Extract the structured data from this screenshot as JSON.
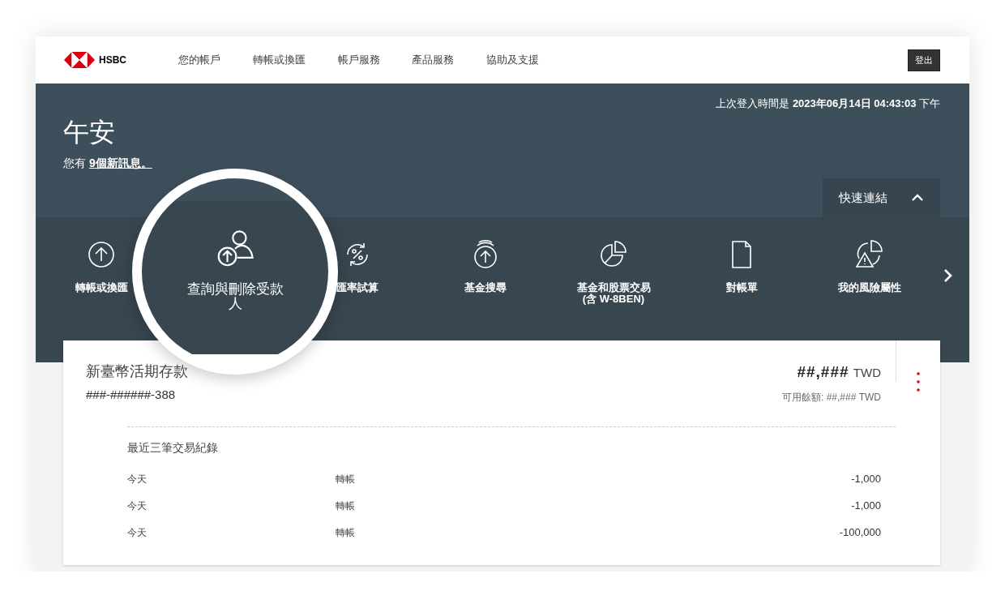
{
  "header": {
    "logo": "HSBC",
    "nav": [
      {
        "label": "您的帳戶",
        "selected": false
      },
      {
        "label": "轉帳或換匯",
        "selected": false
      },
      {
        "label": "帳戶服務",
        "selected": false
      },
      {
        "label": "產品服務",
        "selected": false
      },
      {
        "label": "協助及支援",
        "selected": false
      }
    ],
    "logout": "登出"
  },
  "hero": {
    "last_login_label": "上次登入時間是",
    "last_login_time": "2023年06月14日 04:43:03",
    "last_login_period": "下午",
    "greeting": "午安",
    "message_prefix": "您有",
    "message_link": "9個新訊息。"
  },
  "quick_links": {
    "title": "快速連結",
    "expanded": true,
    "items": [
      {
        "label": "轉帳或換匯",
        "kind": "upload"
      },
      {
        "label": "查詢與刪除受款人",
        "kind": "magnified"
      },
      {
        "label": "匯率試算",
        "kind": "exchange"
      },
      {
        "label": "基金搜尋",
        "kind": "fund"
      },
      {
        "label": "基金和股票交易\n(含 W-8BEN)",
        "kind": "trade"
      },
      {
        "label": "對帳單",
        "kind": "statement"
      },
      {
        "label": "我的風險屬性",
        "kind": "risk"
      }
    ]
  },
  "account": {
    "name": "新臺幣活期存款",
    "number": "###-######-388",
    "balance": "##,###",
    "currency": "TWD",
    "available": "可用餘額: ##,### TWD",
    "recent_title": "最近三筆交易紀錄",
    "transactions": [
      {
        "date": "今天",
        "type": "轉帳",
        "amount": "-1,000"
      },
      {
        "date": "今天",
        "type": "轉帳",
        "amount": "-1,000"
      },
      {
        "date": "今天",
        "type": "轉帳",
        "amount": "-100,000"
      }
    ]
  }
}
